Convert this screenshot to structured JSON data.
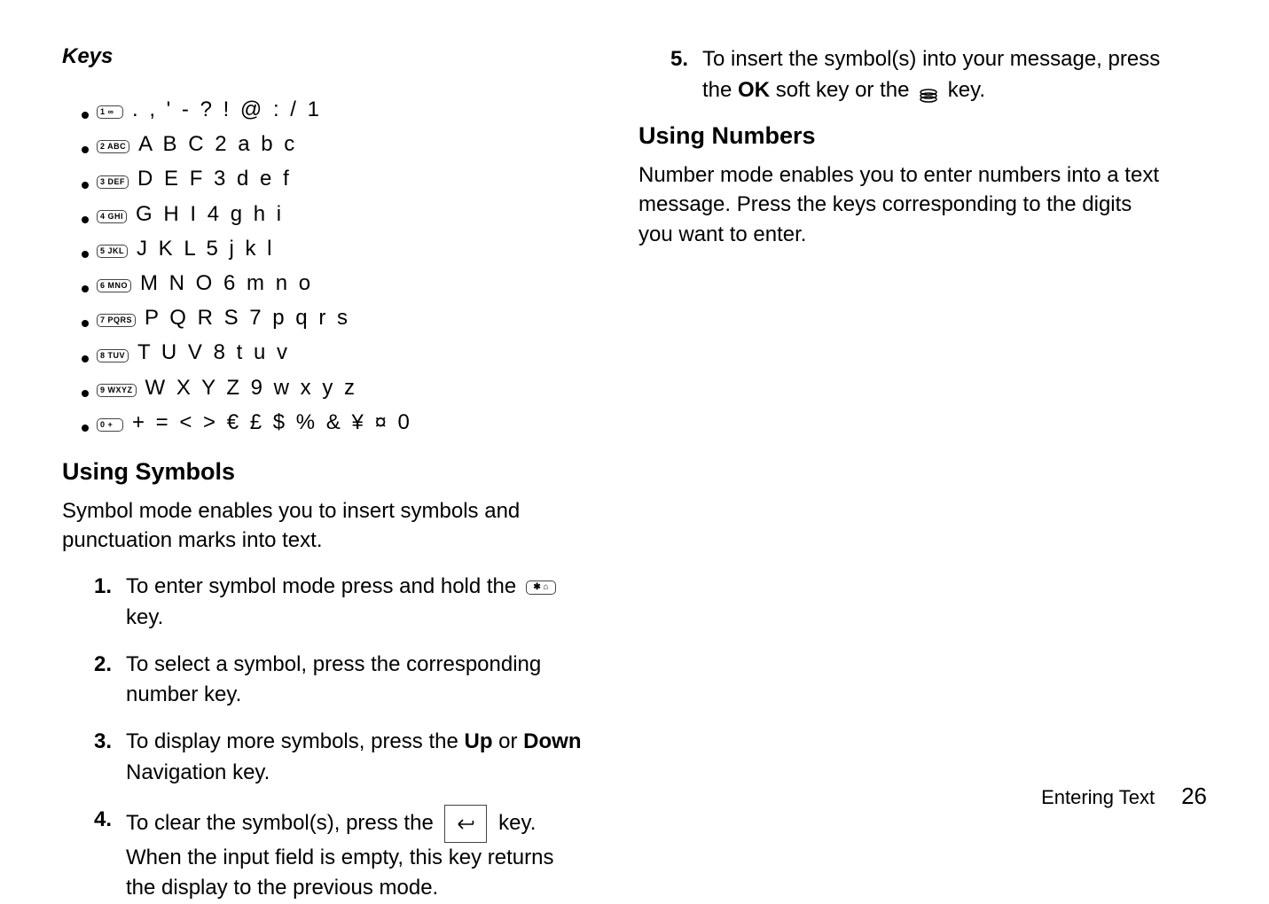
{
  "left": {
    "keys_heading": "Keys",
    "keys": [
      {
        "cap": "1 ∞",
        "chars": ". , ' - ? ! @ : / 1"
      },
      {
        "cap": "2 ABC",
        "chars": "A B C 2 a b c"
      },
      {
        "cap": "3 DEF",
        "chars": "D E F 3 d e f"
      },
      {
        "cap": "4 GHI",
        "chars": "G H I 4 g h i"
      },
      {
        "cap": "5 JKL",
        "chars": "J K L 5 j k l"
      },
      {
        "cap": "6 MNO",
        "chars": "M N O 6 m n o"
      },
      {
        "cap": "7 PQRS",
        "chars": "P Q R S 7 p q r s"
      },
      {
        "cap": "8 TUV",
        "chars": "T U V 8 t u v"
      },
      {
        "cap": "9 WXYZ",
        "chars": "W X Y Z 9 w x y z"
      },
      {
        "cap": "0 +",
        "chars": "+ = < > € £ $ % & ¥ ¤ 0"
      }
    ],
    "symbols_heading": "Using Symbols",
    "symbols_intro": "Symbol mode enables you to insert symbols and punctuation marks into text.",
    "steps": {
      "s1_a": "To enter symbol mode press and hold the ",
      "s1_key": "✱ ⌂",
      "s1_b": " key.",
      "s2": "To select a symbol, press the corresponding number key.",
      "s3_a": "To display more symbols, press the ",
      "s3_up": "Up",
      "s3_or": " or ",
      "s3_down": "Down",
      "s3_b": " Navigation key.",
      "s4_a": "To clear the symbol(s), press the ",
      "s4_key": "↶",
      "s4_b": " key. When the input field is empty, this key returns the display to the previous mode."
    }
  },
  "right": {
    "step5_a": "To insert the symbol(s) into your message, press the ",
    "step5_ok": "OK",
    "step5_b": " soft key or the ",
    "step5_c": " key.",
    "numbers_heading": "Using Numbers",
    "numbers_para": "Number mode enables you to enter numbers into a text message. Press the keys corresponding to the digits you want to enter."
  },
  "footer": {
    "section": "Entering Text",
    "page": "26"
  }
}
